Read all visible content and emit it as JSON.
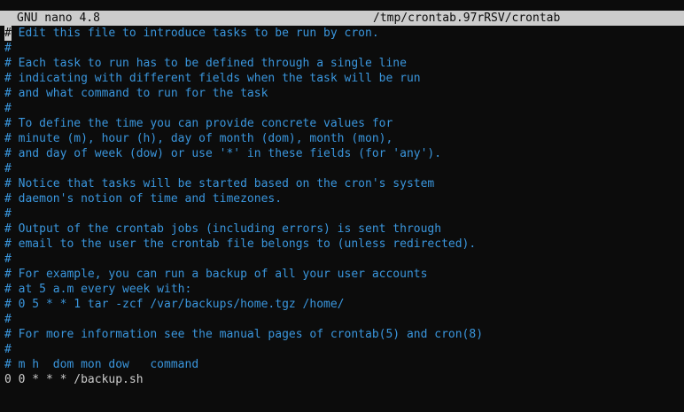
{
  "titlebar": {
    "app_name": "GNU nano 4.8",
    "file_path": "/tmp/crontab.97rRSV/crontab"
  },
  "editor": {
    "cursor_char": "#",
    "first_line_rest": " Edit this file to introduce tasks to be run by cron.",
    "lines": [
      "#",
      "# Each task to run has to be defined through a single line",
      "# indicating with different fields when the task will be run",
      "# and what command to run for the task",
      "#",
      "# To define the time you can provide concrete values for",
      "# minute (m), hour (h), day of month (dom), month (mon),",
      "# and day of week (dow) or use '*' in these fields (for 'any').",
      "#",
      "# Notice that tasks will be started based on the cron's system",
      "# daemon's notion of time and timezones.",
      "#",
      "# Output of the crontab jobs (including errors) is sent through",
      "# email to the user the crontab file belongs to (unless redirected).",
      "#",
      "# For example, you can run a backup of all your user accounts",
      "# at 5 a.m every week with:",
      "# 0 5 * * 1 tar -zcf /var/backups/home.tgz /home/",
      "#",
      "# For more information see the manual pages of crontab(5) and cron(8)",
      "#",
      "# m h  dom mon dow   command"
    ],
    "job_line": "0 0 * * * /backup.sh"
  },
  "colors": {
    "background": "#0c0c0c",
    "comment": "#3a96dd",
    "text": "#cccccc",
    "titlebar_bg": "#cccccc"
  }
}
